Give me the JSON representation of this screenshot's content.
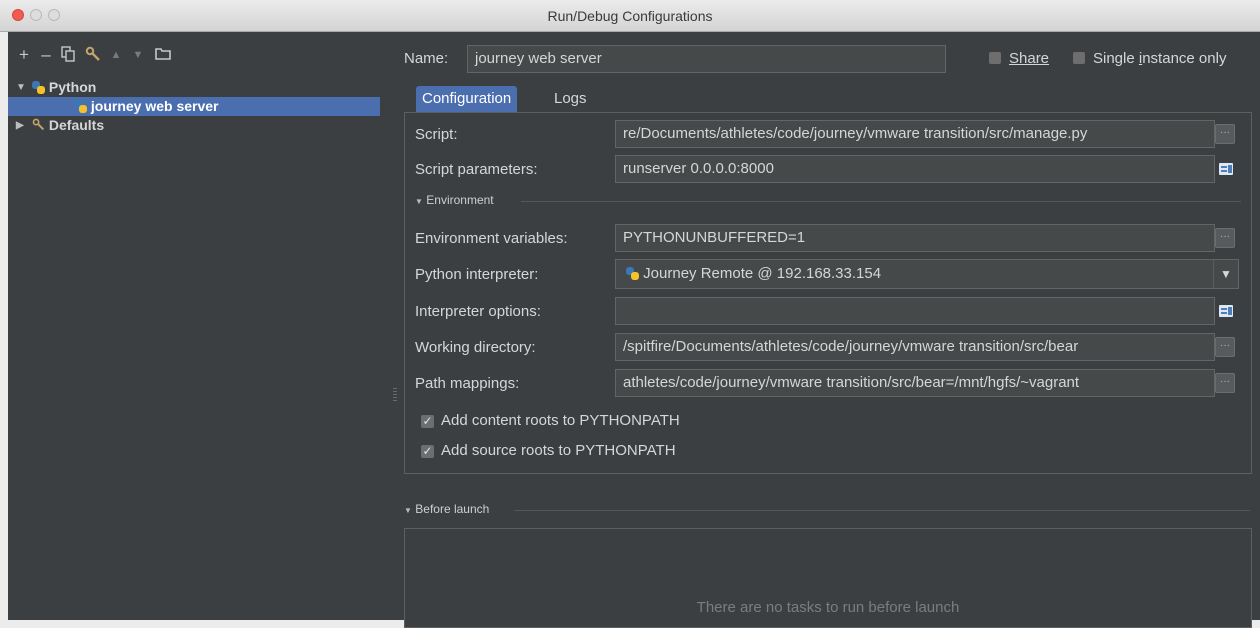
{
  "window": {
    "title": "Run/Debug Configurations"
  },
  "toolbar": {
    "add": "+",
    "remove": "–",
    "copy_icon": "copy-icon",
    "edit_defaults_icon": "wrench-icon",
    "move_up": "▲",
    "move_down": "▼",
    "folder_icon": "folder-icon"
  },
  "tree": {
    "python": {
      "label": "Python",
      "expanded": true
    },
    "selected_item": {
      "label": "journey web server"
    },
    "defaults": {
      "label": "Defaults",
      "expanded": false
    }
  },
  "name_row": {
    "label": "Name:",
    "value": "journey web server"
  },
  "share": {
    "label": "Share"
  },
  "single_instance": {
    "label_pre": "Single ",
    "label_u": "i",
    "label_post": "nstance only"
  },
  "tabs": {
    "configuration": "Configuration",
    "logs": "Logs"
  },
  "config": {
    "script": {
      "label": "Script:",
      "value": "re/Documents/athletes/code/journey/vmware transition/src/manage.py"
    },
    "script_params": {
      "label": "Script parameters:",
      "value": "runserver 0.0.0.0:8000"
    },
    "environment_section": "Environment",
    "env_vars": {
      "label": "Environment variables:",
      "value": "PYTHONUNBUFFERED=1"
    },
    "interpreter": {
      "label": "Python interpreter:",
      "value": "Journey Remote @ 192.168.33.154"
    },
    "interpreter_options": {
      "label": "Interpreter options:",
      "value": ""
    },
    "working_dir": {
      "label": "Working directory:",
      "value": "/spitfire/Documents/athletes/code/journey/vmware transition/src/bear"
    },
    "path_mappings": {
      "label": "Path mappings:",
      "value": "athletes/code/journey/vmware transition/src/bear=/mnt/hgfs/~vagrant"
    },
    "add_content_roots": {
      "label": "Add content roots to PYTHONPATH",
      "checked": true
    },
    "add_source_roots": {
      "label": "Add source roots to PYTHONPATH",
      "checked": true
    }
  },
  "before_launch": {
    "section": "Before launch",
    "empty_message": "There are no tasks to run before launch"
  },
  "colors": {
    "selection": "#4b6eaf",
    "background": "#3c3f41",
    "field": "#45494a",
    "close": "#f25b4f"
  }
}
